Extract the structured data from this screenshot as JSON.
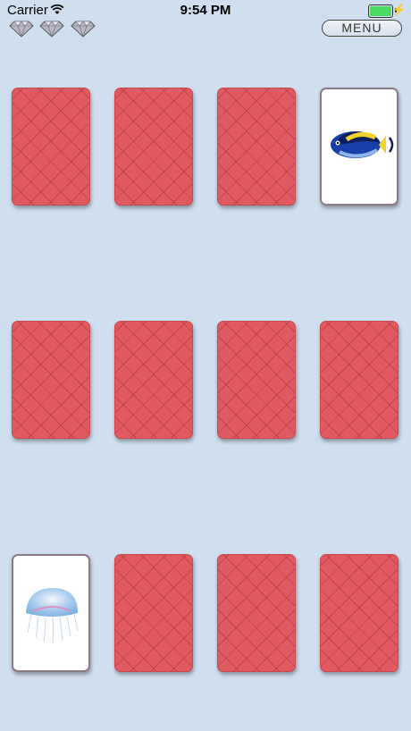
{
  "status_bar": {
    "carrier": "Carrier",
    "time": "9:54 PM",
    "battery_level": 1.0
  },
  "hud": {
    "gem_count": 3,
    "menu_label": "MENU"
  },
  "board": {
    "rows": 3,
    "cols": 4,
    "cards": [
      {
        "state": "face-down"
      },
      {
        "state": "face-down"
      },
      {
        "state": "face-down"
      },
      {
        "state": "face-up",
        "image": "fish-icon"
      },
      {
        "state": "face-down"
      },
      {
        "state": "face-down"
      },
      {
        "state": "face-down"
      },
      {
        "state": "face-down"
      },
      {
        "state": "face-up",
        "image": "jellyfish-icon"
      },
      {
        "state": "face-down"
      },
      {
        "state": "face-down"
      },
      {
        "state": "face-down"
      }
    ]
  },
  "colors": {
    "background": "#d0dff0",
    "card_back": "#e05a60",
    "card_face": "#ffffff"
  }
}
